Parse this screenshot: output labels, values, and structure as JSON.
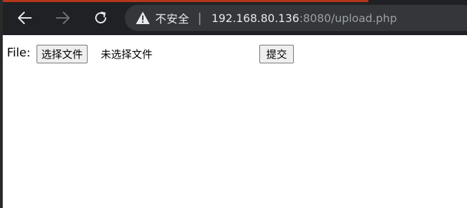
{
  "toolbar": {
    "back_icon": "arrow-left-icon",
    "forward_icon": "arrow-right-icon",
    "reload_icon": "reload-icon",
    "security_icon": "warning-triangle-icon",
    "security_text": "不安全",
    "separator": "|",
    "url_host": "192.168.80.136",
    "url_rest": ":8080/upload.php"
  },
  "form": {
    "label": "File:",
    "choose_button": "选择文件",
    "no_file_text": "未选择文件",
    "submit_button": "提交"
  },
  "colors": {
    "toolbar_bg": "#202124",
    "omnibox_bg": "#35363a",
    "tab_accent": "#b5361a"
  }
}
